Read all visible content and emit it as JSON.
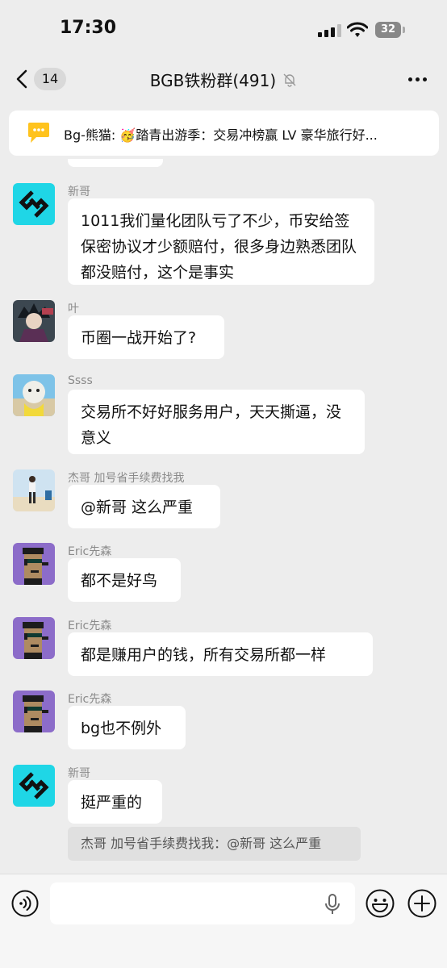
{
  "status_bar": {
    "time": "17:30",
    "battery": "32"
  },
  "nav": {
    "back_badge": "14",
    "title": "BGB铁粉群(491)"
  },
  "announcement": {
    "text": "Bg-熊猫: 🥳踏青出游季：交易冲榜赢 LV 豪华旅行好..."
  },
  "messages": [
    {
      "sender": "新哥",
      "avatar": "bitget-logo",
      "text": "1011我们量化团队亏了不少，币安给签保密协议才少额赔付，很多身边熟悉团队都没赔付，这个是事实"
    },
    {
      "sender": "叶",
      "avatar": "anime-avatar",
      "text": "币圈一战开始了?"
    },
    {
      "sender": "Ssss",
      "avatar": "dog-avatar",
      "text": "交易所不好好服务用户，天天撕逼，没意义"
    },
    {
      "sender": "杰哥 加号省手续费找我",
      "avatar": "beach-photo-avatar",
      "text": "@新哥 这么严重"
    },
    {
      "sender": "Eric先森",
      "avatar": "pixel-punk-avatar",
      "text": "都不是好鸟"
    },
    {
      "sender": "Eric先森",
      "avatar": "pixel-punk-avatar",
      "text": "都是赚用户的钱，所有交易所都一样"
    },
    {
      "sender": "Eric先森",
      "avatar": "pixel-punk-avatar",
      "text": "bg也不例外"
    },
    {
      "sender": "新哥",
      "avatar": "bitget-logo",
      "text": "挺严重的"
    }
  ],
  "quote": {
    "text": "杰哥 加号省手续费找我：@新哥 这么严重"
  },
  "input": {
    "placeholder": ""
  },
  "colors": {
    "background": "#ededed",
    "bubble": "#ffffff",
    "bitget_cyan": "#1fd6e6",
    "sender_gray": "#8a8a8a"
  }
}
